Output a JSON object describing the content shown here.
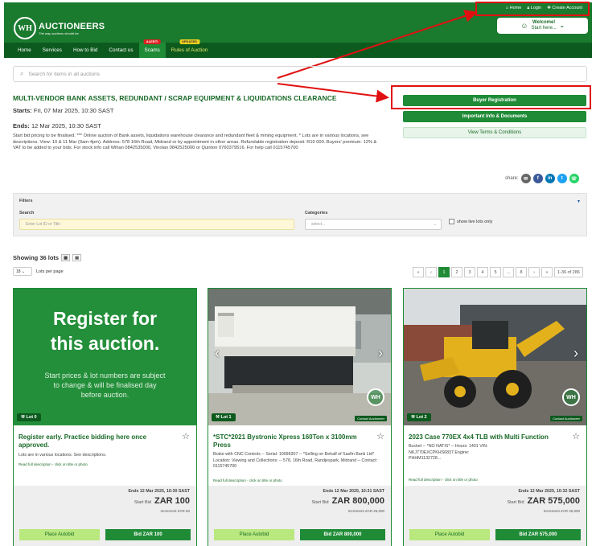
{
  "site": {
    "logo_initials": "WH",
    "name": "AUCTIONEERS",
    "tagline": "The way auctions should be."
  },
  "toplinks": {
    "home": "Home",
    "login": "Login",
    "create": "Create Account"
  },
  "welcome": {
    "text": "Welcome!",
    "sub": "Start here..."
  },
  "nav": [
    {
      "label": "Home"
    },
    {
      "label": "Services"
    },
    {
      "label": "How to Bid"
    },
    {
      "label": "Contact us"
    },
    {
      "label": "Scams",
      "badge": "ALERT!"
    },
    {
      "label": "Rules of Auction",
      "badge": "UPDATED"
    }
  ],
  "search": {
    "placeholder": "Search for items in all auctions"
  },
  "auction": {
    "title": "MULTI-VENDOR BANK ASSETS, REDUNDANT / SCRAP EQUIPMENT & LIQUIDATIONS CLEARANCE",
    "starts_label": "Starts:",
    "starts": "Fri, 07 Mar 2025, 10:30 SAST",
    "ends_label": "Ends:",
    "ends": "12 Mar 2025, 10:30 SAST",
    "description": "Start bid pricing to be finalised. *** Online auction of Bank assets, liquidations warehouse clearance and redundant fleet & mining equipment. * Lots are in various locations, see descriptions. View: 10 & 11 Mar (9am-4pm). Address: 578 16th Road, Midrand or by appointment in other areas. Refundable registration deposit: R10 000. Buyers' premium: 12% & VAT to be added to your bids. For stock info call Wihan 0842535000, Vinolan 0842525000 or Quinton 0760379516. For help call 0115745700"
  },
  "buttons": {
    "register": "Buyer Registration",
    "info": "Important Info & Documents",
    "terms": "View Terms & Conditions"
  },
  "share": {
    "label": "share:"
  },
  "filters": {
    "title": "Filters",
    "search_label": "Search",
    "search_placeholder": "Enter Lot ID or Title",
    "cat_label": "Categories",
    "cat_value": "select...",
    "live_label": "show live lots only"
  },
  "listing": {
    "showing": "Showing 36 lots",
    "per_page": "18",
    "per_page_label": "Lots per page"
  },
  "pager": {
    "items": [
      "«",
      "‹",
      "1",
      "2",
      "3",
      "4",
      "5",
      "...",
      "8",
      "›",
      "»"
    ],
    "range": "1-36 of 286"
  },
  "promo": {
    "headline": "Register for this auction.",
    "sub": "Start prices & lot numbers are subject to change & will be finalised day before auction."
  },
  "lots": [
    {
      "lot": "Lot 0",
      "title": "Register early. Practice bidding here once approved.",
      "desc": "Lots are in various locations. See descriptions.",
      "read": "Read full description - click on title or photo",
      "ends": "Ends 12 Mar 2025, 10:30 SAST",
      "start_label": "Start Bid",
      "price": "ZAR 100",
      "inc": "Increment ZAR 50",
      "autobid": "Place Autobid",
      "bid": "Bid ZAR 100"
    },
    {
      "lot": "Lot 1",
      "contact": "Contact Auctioneer",
      "title": "*STC*2021 Bystronic Xpress 160Ton x 3100mm Press",
      "desc": "Brake with CNC Controls -- Serial: 10096307 -- *Selling on Behalf of Sasfin Bank Ltd* Location: Viewing and Collections: -- 578, 16th Road, Randjespark, Midrand -- Contact: 0115745700",
      "read": "Read full description - click on title or photo",
      "ends": "Ends 12 Mar 2025, 10:31 SAST",
      "start_label": "Start Bid",
      "price": "ZAR 800,000",
      "inc": "Increment ZAR 25,000",
      "autobid": "Place Autobid",
      "bid": "Bid ZAR 800,000"
    },
    {
      "lot": "Lot 2",
      "contact": "Contact Auctioneer",
      "title": "2023 Case 770EX 4x4 TLB with Multi Function",
      "desc": "Bucket -- *NO NATIS* -- Hours: 1401 VIN: NKJ770EXCPKHS6837 Engine: PHHM1132728...",
      "read": "Read full description - click on title or photo",
      "ends": "Ends 12 Mar 2025, 10:32 SAST",
      "start_label": "Start Bid",
      "price": "ZAR 575,000",
      "inc": "Increment ZAR 25,000",
      "autobid": "Place Autobid",
      "bid": "Bid ZAR 575,000"
    }
  ],
  "colors": {
    "brand": "#1a7a2e",
    "nav": "#0d5a1e",
    "accent": "#1f8b36",
    "annotation": "#e01010",
    "autobid": "#b8e87e"
  }
}
